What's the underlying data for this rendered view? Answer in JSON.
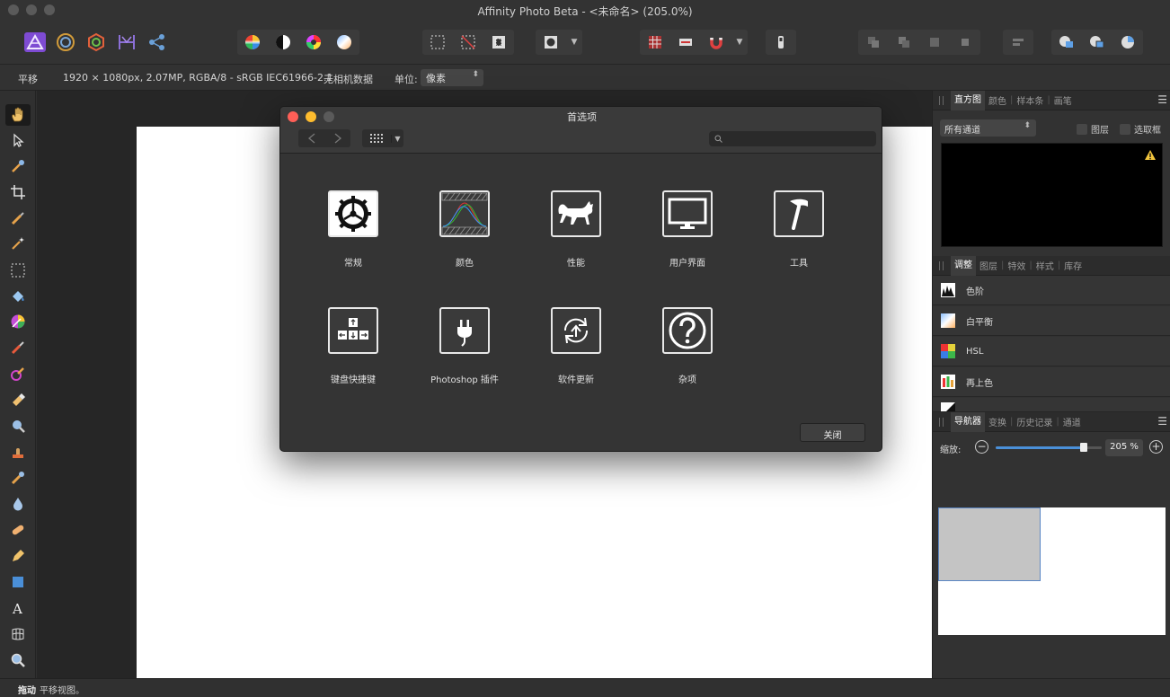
{
  "window": {
    "title": "Affinity Photo Beta - <未命名> (205.0%)"
  },
  "context_bar": {
    "tool_name": "平移",
    "doc_info": "1920 × 1080px, 2.07MP, RGBA/8 - sRGB IEC61966-2.1",
    "camera_info": "无相机数据",
    "unit_label": "单位:",
    "unit_value": "像素"
  },
  "status_bar": {
    "action": "拖动",
    "hint": "平移视图。"
  },
  "histogram_panel": {
    "tabs": [
      "直方图",
      "颜色",
      "样本条",
      "画笔"
    ],
    "channel_select": "所有通道",
    "layer_checkbox": "图层",
    "selection_checkbox": "选取框"
  },
  "adjustment_panel": {
    "tabs": [
      "调整",
      "图层",
      "特效",
      "样式",
      "库存"
    ],
    "items": [
      "色阶",
      "白平衡",
      "HSL",
      "再上色"
    ]
  },
  "navigator_panel": {
    "tabs": [
      "导航器",
      "变换",
      "历史记录",
      "通道"
    ],
    "zoom_label": "缩放:",
    "zoom_value": "205 %",
    "zoom_fraction": 0.83
  },
  "preferences_dialog": {
    "title": "首选项",
    "close_button": "关闭",
    "items": [
      {
        "label": "常规",
        "icon": "gear-icon"
      },
      {
        "label": "颜色",
        "icon": "color-curves-icon"
      },
      {
        "label": "性能",
        "icon": "cat-icon"
      },
      {
        "label": "用户界面",
        "icon": "monitor-icon"
      },
      {
        "label": "工具",
        "icon": "hammer-icon"
      },
      {
        "label": "键盘快捷键",
        "icon": "keyboard-icon"
      },
      {
        "label": "Photoshop 插件",
        "icon": "plug-icon"
      },
      {
        "label": "软件更新",
        "icon": "update-icon"
      },
      {
        "label": "杂项",
        "icon": "question-icon"
      }
    ]
  },
  "colors": {
    "accent": "#4a90d9",
    "close_light": "#fe5f57",
    "minimize_light": "#febc2e",
    "zoom_light": "#5a5a5a",
    "affinity_brand": "#7e4bd3"
  }
}
